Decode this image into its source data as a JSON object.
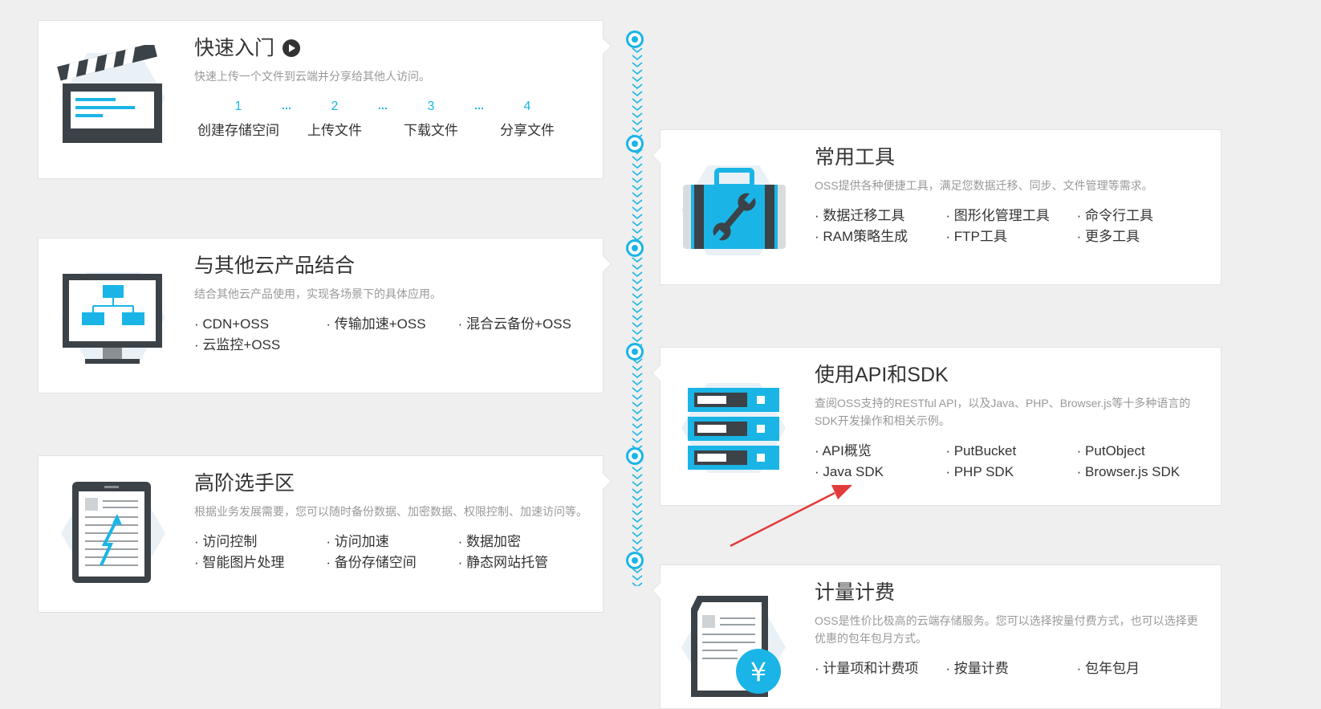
{
  "colors": {
    "accent": "#1ab5e6",
    "arrow": "#e23b3b",
    "card_bg": "#ffffff",
    "page_bg": "#efefef"
  },
  "quickstart": {
    "title": "快速入门",
    "desc": "快速上传一个文件到云端并分享给其他人访问。",
    "steps": [
      {
        "num": "1",
        "label": "创建存储空间"
      },
      {
        "num": "2",
        "label": "上传文件"
      },
      {
        "num": "3",
        "label": "下载文件"
      },
      {
        "num": "4",
        "label": "分享文件"
      }
    ]
  },
  "tools": {
    "title": "常用工具",
    "desc": "OSS提供各种便捷工具，满足您数据迁移、同步、文件管理等需求。",
    "links": [
      "数据迁移工具",
      "图形化管理工具",
      "命令行工具",
      "RAM策略生成",
      "FTP工具",
      "更多工具"
    ]
  },
  "integrate": {
    "title": "与其他云产品结合",
    "desc": "结合其他云产品使用，实现各场景下的具体应用。",
    "links": [
      "CDN+OSS",
      "传输加速+OSS",
      "混合云备份+OSS",
      "云监控+OSS"
    ]
  },
  "sdk": {
    "title": "使用API和SDK",
    "desc": "查阅OSS支持的RESTful API，以及Java、PHP、Browser.js等十多种语言的SDK开发操作和相关示例。",
    "links": [
      "API概览",
      "PutBucket",
      "PutObject",
      "Java SDK",
      "PHP SDK",
      "Browser.js SDK"
    ]
  },
  "advanced": {
    "title": "高阶选手区",
    "desc": "根据业务发展需要，您可以随时备份数据、加密数据、权限控制、加速访问等。",
    "links": [
      "访问控制",
      "访问加速",
      "数据加密",
      "智能图片处理",
      "备份存储空间",
      "静态网站托管"
    ]
  },
  "billing": {
    "title": "计量计费",
    "desc": "OSS是性价比极高的云端存储服务。您可以选择按量付费方式，也可以选择更优惠的包年包月方式。",
    "links": [
      "计量项和计费项",
      "按量计费",
      "包年包月"
    ],
    "yuan": "¥"
  }
}
